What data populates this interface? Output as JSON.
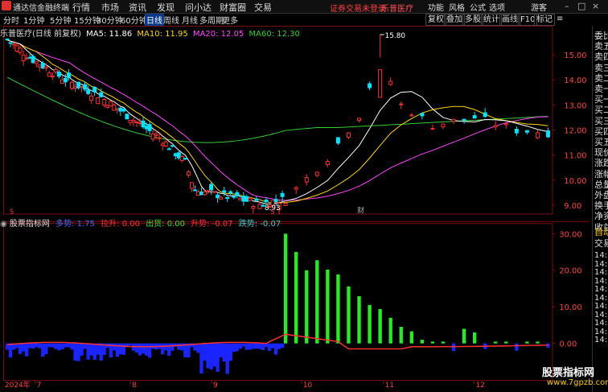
{
  "app": {
    "title": "通达信金融终端",
    "menus": [
      "行情",
      "市场",
      "资讯",
      "发现",
      "问小达",
      "财富圈",
      "交易"
    ],
    "warning": "证券交易未登录",
    "stock_name_top": "乐普医疗",
    "right_menus": [
      "功能",
      "风格",
      "公式",
      "选项"
    ],
    "user": "游客"
  },
  "periods": {
    "items": [
      "分时",
      "1分钟",
      "5分钟",
      "15分钟",
      "30分钟",
      "60分钟",
      "日线",
      "周线",
      "月线",
      "多周期",
      "更多"
    ],
    "active": "日线"
  },
  "toolbar": {
    "right_buttons": [
      "复权",
      "叠加",
      "多股",
      "统计",
      "画线",
      "F10",
      "标记"
    ]
  },
  "main_chart": {
    "stock_label": "乐普医疗(日线 前复权)",
    "ma5": "MA5: 11.86",
    "ma10": "MA10: 11.95",
    "ma20": "MA20: 12.05",
    "ma60": "MA60: 12.30",
    "high_label": "15.80",
    "low_label": "8.93",
    "event_label": "财",
    "marker_s1": "S",
    "marker_s2": "S"
  },
  "indicator": {
    "name": "股票指标网",
    "items": [
      {
        "label": "多势: 1.75",
        "color": "#3a6bff"
      },
      {
        "label": "拉升: 0.00",
        "color": "#ff3030"
      },
      {
        "label": "出货: 0.00",
        "color": "#33dd33"
      },
      {
        "label": "升势: -0.07",
        "color": "#ff3030"
      },
      {
        "label": "跌势: -0.07",
        "color": "#33cccc"
      }
    ]
  },
  "date_axis": {
    "labels": [
      "2024年",
      "7",
      "8",
      "9",
      "10",
      "11",
      "12"
    ]
  },
  "right_panel": {
    "items": [
      "委比",
      "卖五",
      "卖四",
      "卖三",
      "卖二",
      "卖一",
      "买一",
      "买二",
      "买三",
      "买四",
      "买五",
      "现价",
      "涨跌",
      "涨幅",
      "总量",
      "外盘",
      "换手",
      "净资",
      "收益",
      "自动",
      "交易",
      "14:5",
      "14:5",
      "14:5",
      "14:5",
      "14:5",
      "14:5",
      "14:5",
      "14:5",
      "14:5",
      "14:5",
      "14:5"
    ]
  },
  "watermark": {
    "line1": "股票指标网",
    "line2": "www.7gpzb.com"
  },
  "chart_data": {
    "price_axis": [
      "15.00",
      "14.00",
      "13.00",
      "12.00",
      "11.00",
      "10.00",
      "9.00"
    ],
    "indicator_axis": [
      "30.00",
      "20.00",
      "10.00",
      "0.00"
    ],
    "price_range": [
      8.7,
      15.9
    ],
    "indicator_range": [
      -10,
      32
    ]
  },
  "colors": {
    "up": "#ff3030",
    "down": "#00e5ff",
    "ma5": "#ffffff",
    "ma10": "#ffd700",
    "ma20": "#ff44ff",
    "ma60": "#33cc33",
    "bar_blue": "#1a24ff",
    "bar_green": "#22ee22"
  }
}
